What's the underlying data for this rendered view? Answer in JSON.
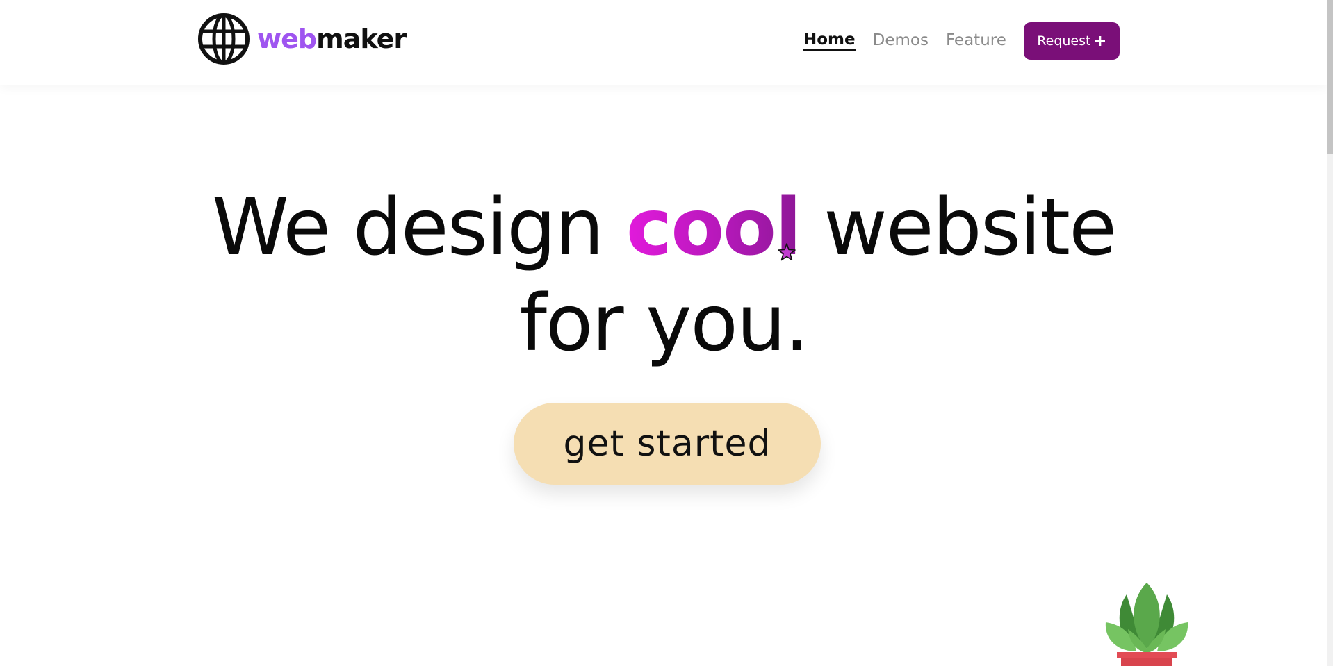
{
  "header": {
    "logo": {
      "icon": "globe-icon",
      "text_accent": "web",
      "text_main": "maker",
      "accent_color": "#9f55f0"
    },
    "nav": {
      "items": [
        {
          "label": "Home",
          "active": true
        },
        {
          "label": "Demos",
          "active": false
        },
        {
          "label": "Feature",
          "active": false
        }
      ],
      "request_button": {
        "label": "Request",
        "icon": "plus-icon",
        "color": "#7a0f78"
      }
    }
  },
  "hero": {
    "line1_before": "We design ",
    "line1_highlight": "cool",
    "line1_after": " website",
    "line2": "for you.",
    "highlight_gradient": [
      "#e21adc",
      "#8d1796"
    ],
    "cta_label": "get started",
    "cta_color": "#f5deb3"
  },
  "decor": {
    "cursor_icon": "star-cursor-icon",
    "plant_icon": "potted-plant-icon"
  }
}
